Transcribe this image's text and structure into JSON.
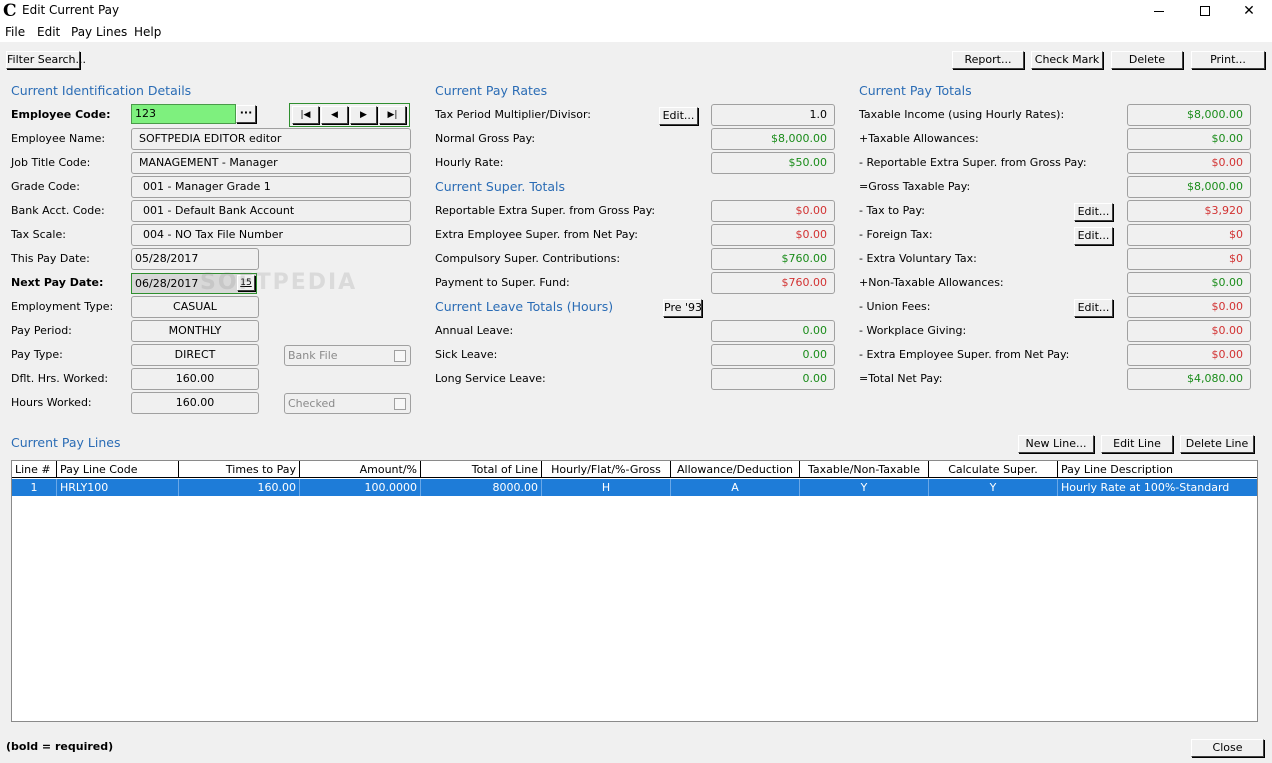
{
  "window": {
    "title": "Edit Current Pay",
    "app_icon": "C",
    "minimize_icon": "minimize-icon",
    "maximize_icon": "maximize-icon",
    "close_glyph": "✕"
  },
  "menu": {
    "file": "File",
    "edit": "Edit",
    "pay_lines": "Pay Lines",
    "help": "Help"
  },
  "toolbar": {
    "filter_search": "Filter Search...",
    "report": "Report...",
    "check_mark": "Check Mark",
    "delete": "Delete",
    "print": "Print..."
  },
  "identification": {
    "title": "Current Identification Details",
    "employee_code_label": "Employee Code:",
    "employee_code": "123",
    "lookup_button": "···",
    "nav": {
      "first": "|◀",
      "prev": "◀",
      "next": "▶",
      "last": "▶|"
    },
    "employee_name_label": "Employee Name:",
    "employee_name": "SOFTPEDIA EDITOR editor",
    "job_title_label": "Job Title Code:",
    "job_title": "MANAGEMENT - Manager",
    "grade_label": "Grade Code:",
    "grade": "001 - Manager Grade 1",
    "bank_label": "Bank Acct. Code:",
    "bank": "001 - Default Bank Account",
    "tax_scale_label": "Tax Scale:",
    "tax_scale": "004 - NO Tax File Number",
    "this_pay_date_label": "This Pay Date:",
    "this_pay_date": "05/28/2017",
    "next_pay_date_label": "Next Pay Date:",
    "next_pay_date": "06/28/2017",
    "calendar_glyph": "15",
    "employment_type_label": "Employment Type:",
    "employment_type": "CASUAL",
    "pay_period_label": "Pay Period:",
    "pay_period": "MONTHLY",
    "pay_type_label": "Pay Type:",
    "pay_type": "DIRECT",
    "bank_file": "Bank File",
    "dflt_hours_label": "Dflt. Hrs. Worked:",
    "dflt_hours": "160.00",
    "hours_worked_label": "Hours Worked:",
    "hours_worked": "160.00",
    "checked": "Checked"
  },
  "pay_rates": {
    "title": "Current Pay Rates",
    "multiplier_label": "Tax Period Multiplier/Divisor:",
    "edit": "Edit...",
    "multiplier": "1.0",
    "normal_gross_label": "Normal Gross Pay:",
    "normal_gross": "$8,000.00",
    "hourly_rate_label": "Hourly Rate:",
    "hourly_rate": "$50.00"
  },
  "super_totals": {
    "title": "Current Super. Totals",
    "reportable_label": "Reportable Extra Super. from Gross Pay:",
    "reportable": "$0.00",
    "extra_employee_label": "Extra Employee Super. from Net Pay:",
    "extra_employee": "$0.00",
    "compulsory_label": "Compulsory Super. Contributions:",
    "compulsory": "$760.00",
    "payment_label": "Payment to Super. Fund:",
    "payment": "$760.00"
  },
  "leave_totals": {
    "title": "Current Leave Totals (Hours)",
    "pre93": "Pre '93",
    "annual_label": "Annual Leave:",
    "annual": "0.00",
    "sick_label": "Sick Leave:",
    "sick": "0.00",
    "long_service_label": "Long Service Leave:",
    "long_service": "0.00"
  },
  "pay_totals": {
    "title": "Current Pay Totals",
    "edit": "Edit...",
    "taxable_income_label": "Taxable Income (using Hourly Rates):",
    "taxable_income": "$8,000.00",
    "taxable_allowances_label": "+Taxable Allowances:",
    "taxable_allowances": "$0.00",
    "reportable_label": "- Reportable Extra Super. from Gross Pay:",
    "reportable": "$0.00",
    "gross_taxable_label": "=Gross Taxable Pay:",
    "gross_taxable": "$8,000.00",
    "tax_to_pay_label": "- Tax to Pay:",
    "tax_to_pay": "$3,920",
    "foreign_tax_label": "- Foreign Tax:",
    "foreign_tax": "$0",
    "voluntary_tax_label": "- Extra Voluntary Tax:",
    "voluntary_tax": "$0",
    "non_taxable_label": "+Non-Taxable Allowances:",
    "non_taxable": "$0.00",
    "union_fees_label": "- Union Fees:",
    "union_fees": "$0.00",
    "workplace_giving_label": "- Workplace Giving:",
    "workplace_giving": "$0.00",
    "extra_employee_label": "- Extra Employee Super. from Net Pay:",
    "extra_employee": "$0.00",
    "total_net_label": "=Total Net Pay:",
    "total_net": "$4,080.00"
  },
  "pay_lines": {
    "title": "Current Pay Lines",
    "new_line": "New Line...",
    "edit_line": "Edit Line",
    "delete_line": "Delete Line",
    "columns": [
      "Line #",
      "Pay Line Code",
      "Times to Pay",
      "Amount/%",
      "Total of Line",
      "Hourly/Flat/%-Gross",
      "Allowance/Deduction",
      "Taxable/Non-Taxable",
      "Calculate Super.",
      "Pay Line Description"
    ],
    "rows": [
      [
        "1",
        "HRLY100",
        "160.00",
        "100.0000",
        "8000.00",
        "H",
        "A",
        "Y",
        "Y",
        "Hourly Rate at 100%-Standard"
      ]
    ]
  },
  "footer": {
    "hint": "(bold = required)",
    "close": "Close"
  },
  "watermark": "SOFTPEDIA",
  "colors": {
    "accent_title": "#2a6cb5",
    "positive": "#1a8c1a",
    "negative": "#d23232",
    "selection": "#1e7cd8",
    "highlight_field": "#7ef07e"
  }
}
